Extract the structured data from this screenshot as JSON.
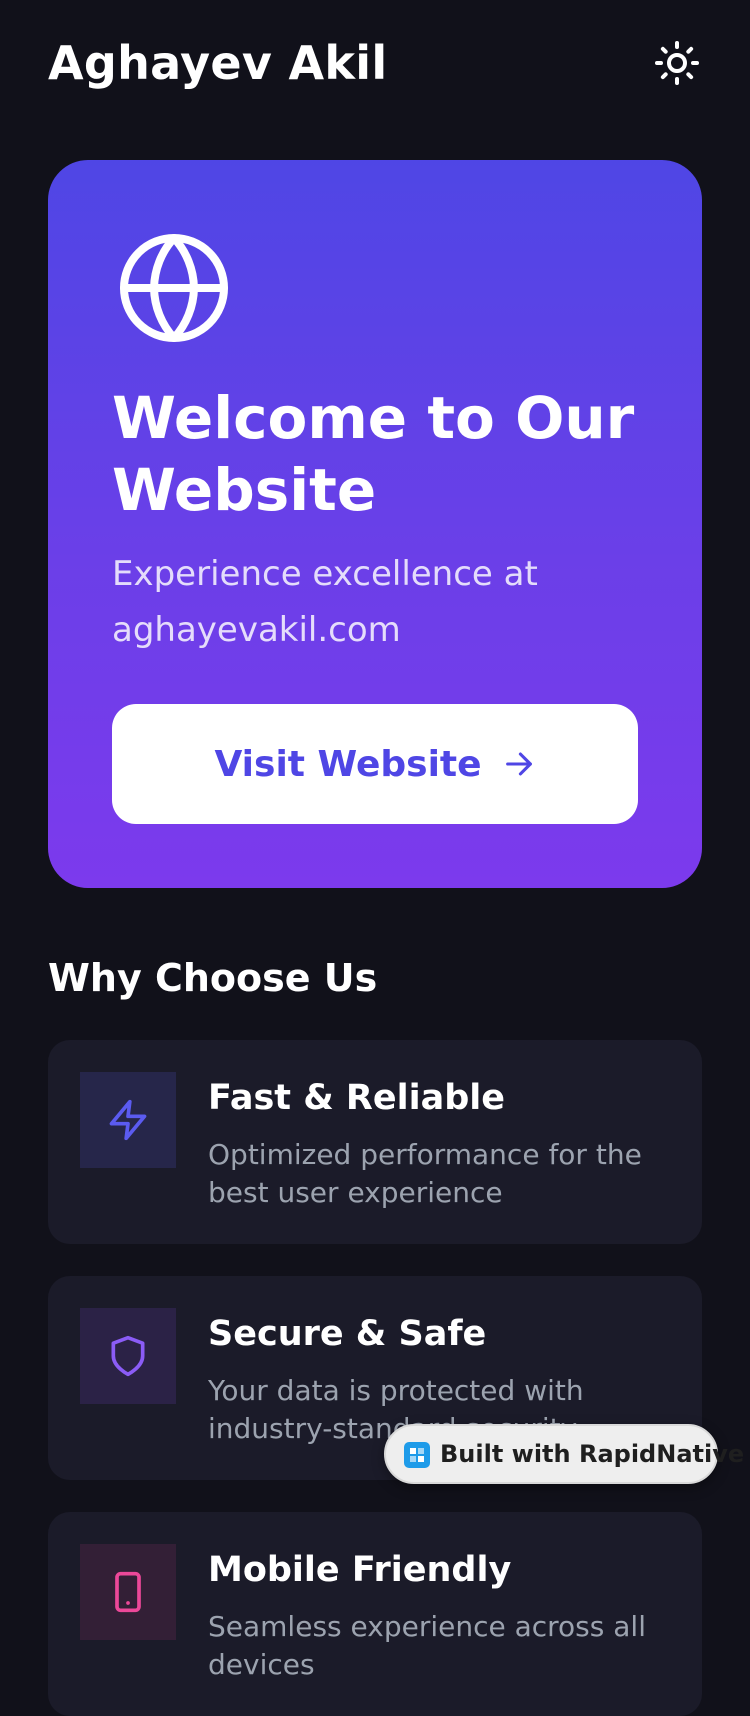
{
  "header": {
    "title": "Aghayev Akil",
    "theme_toggle_icon": "sun-icon"
  },
  "hero": {
    "icon": "globe-icon",
    "title": "Welcome to Our Website",
    "subtitle": "Experience excellence at aghayevakil.com",
    "button_label": "Visit Website",
    "button_icon": "arrow-right-icon",
    "gradient_start": "#4f46e5",
    "gradient_end": "#7c3aed"
  },
  "features": {
    "section_title": "Why Choose Us",
    "items": [
      {
        "icon": "lightning-icon",
        "title": "Fast & Reliable",
        "description": "Optimized performance for the best user experience",
        "icon_color": "#5b5bf0"
      },
      {
        "icon": "shield-icon",
        "title": "Secure & Safe",
        "description": "Your data is protected with industry-standard security",
        "icon_color": "#8b5cf6"
      },
      {
        "icon": "phone-icon",
        "title": "Mobile Friendly",
        "description": "Seamless experience across all devices",
        "icon_color": "#ec4899"
      }
    ]
  },
  "badge": {
    "label": "Built with RapidNative",
    "icon": "rapidnative-logo-icon"
  }
}
